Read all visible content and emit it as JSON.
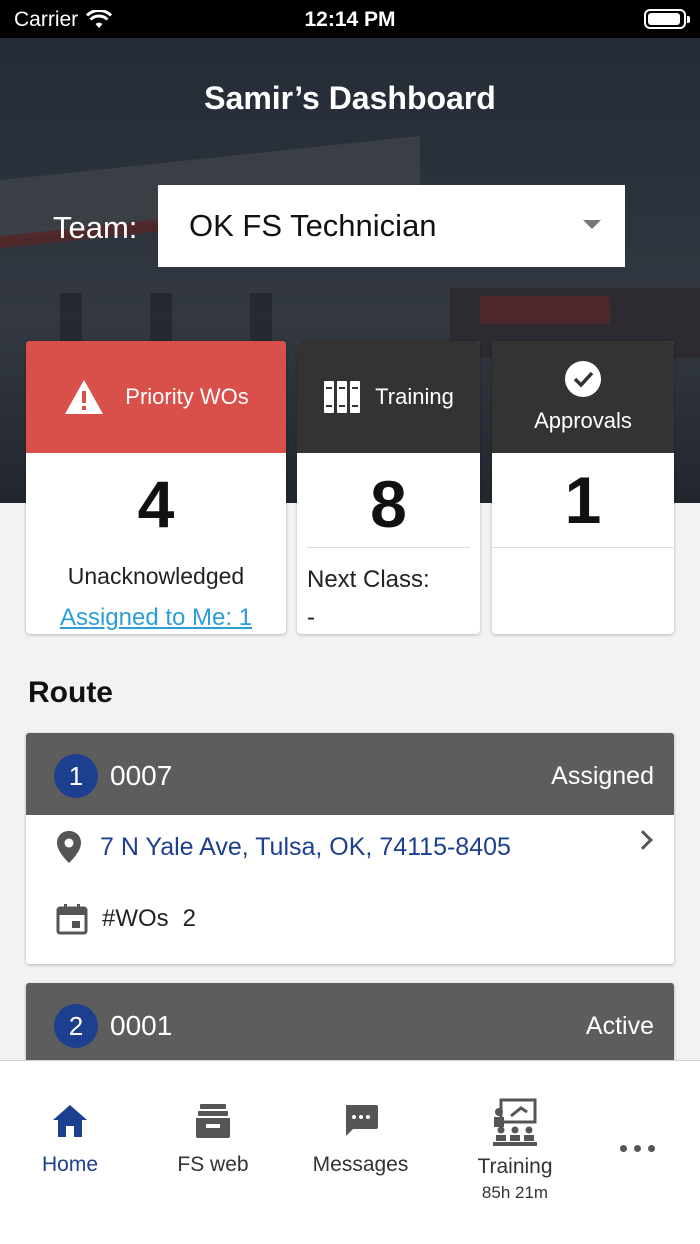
{
  "status_bar": {
    "carrier": "Carrier",
    "time": "12:14 PM"
  },
  "header": {
    "title": "Samir’s Dashboard"
  },
  "team": {
    "label": "Team:",
    "selected": "OK FS Technician"
  },
  "cards": {
    "priority": {
      "title": "Priority WOs",
      "count": "4",
      "subtitle": "Unacknowledged",
      "link": "Assigned to Me: 1"
    },
    "training": {
      "title": "Training",
      "count": "8",
      "next_label": "Next Class:",
      "next_value": "-"
    },
    "approvals": {
      "title": "Approvals",
      "count": "1"
    }
  },
  "route": {
    "title": "Route",
    "items": [
      {
        "number": "1",
        "store": "0007",
        "status": "Assigned",
        "address": "7 N Yale Ave, Tulsa, OK, 74115-8405",
        "wo_label": "#WOs",
        "wo_count": "2"
      },
      {
        "number": "2",
        "store": "0001",
        "status": "Active"
      }
    ]
  },
  "tabbar": {
    "home": "Home",
    "fsweb": "FS web",
    "messages": "Messages",
    "training": "Training",
    "training_sub": "85h 21m"
  },
  "colors": {
    "accent": "#1d3f8f",
    "priority": "#d9504b",
    "dark_header": "#333333",
    "route_header": "#5d5d5d",
    "link": "#2b9ed8"
  }
}
